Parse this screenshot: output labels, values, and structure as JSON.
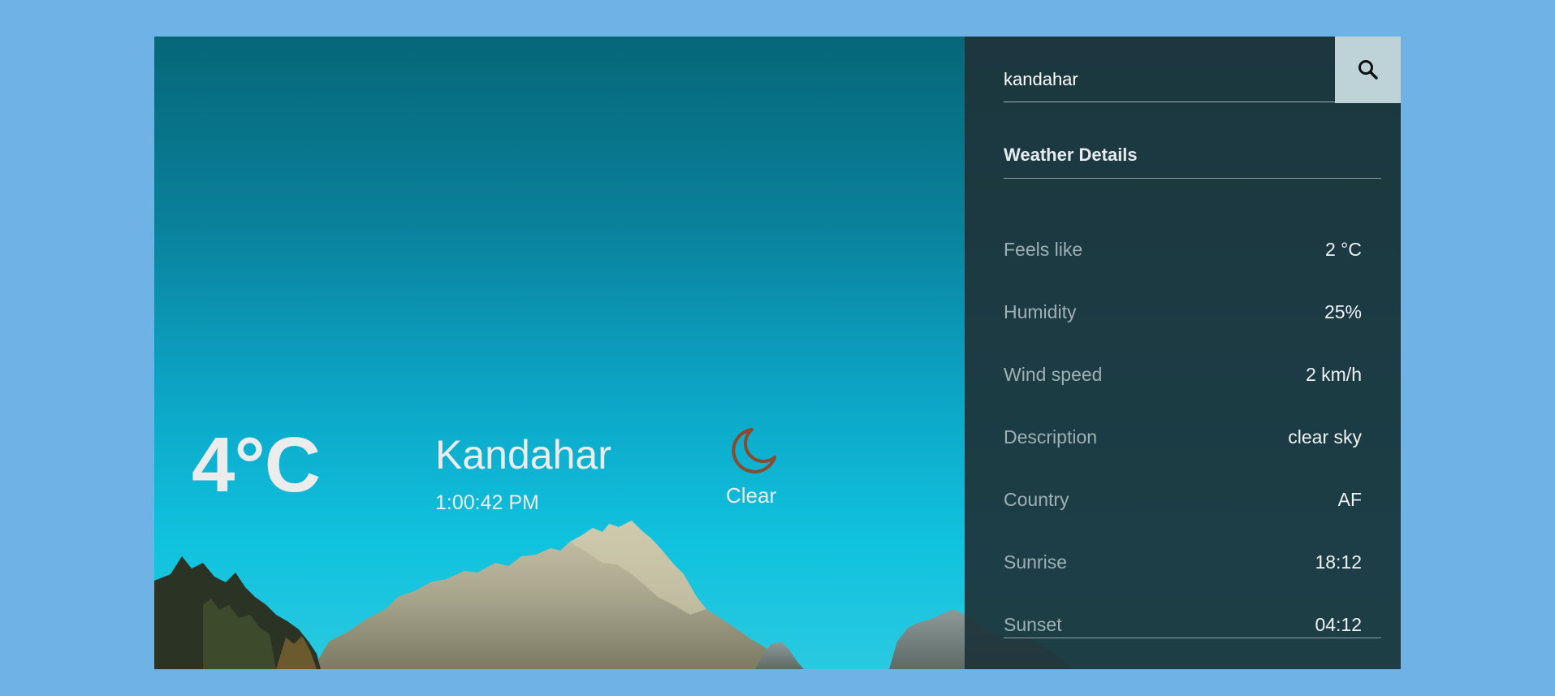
{
  "current": {
    "temperature": "4°C",
    "city": "Kandahar",
    "time": "1:00:42 PM",
    "condition": "Clear",
    "condition_icon": "moon-icon"
  },
  "search": {
    "value": "kandahar",
    "button_icon": "search-icon"
  },
  "details": {
    "title": "Weather Details",
    "rows": [
      {
        "label": "Feels like",
        "value": "2 °C"
      },
      {
        "label": "Humidity",
        "value": "25%"
      },
      {
        "label": "Wind speed",
        "value": "2 km/h"
      },
      {
        "label": "Description",
        "value": "clear sky"
      },
      {
        "label": "Country",
        "value": "AF"
      },
      {
        "label": "Sunrise",
        "value": "18:12"
      },
      {
        "label": "Sunset",
        "value": "04:12"
      }
    ]
  },
  "colors": {
    "page_background": "#6fb2e6",
    "panel_background": "#1e343a",
    "search_button": "#bdd3d8",
    "moon_icon": "#8b4a2e"
  }
}
